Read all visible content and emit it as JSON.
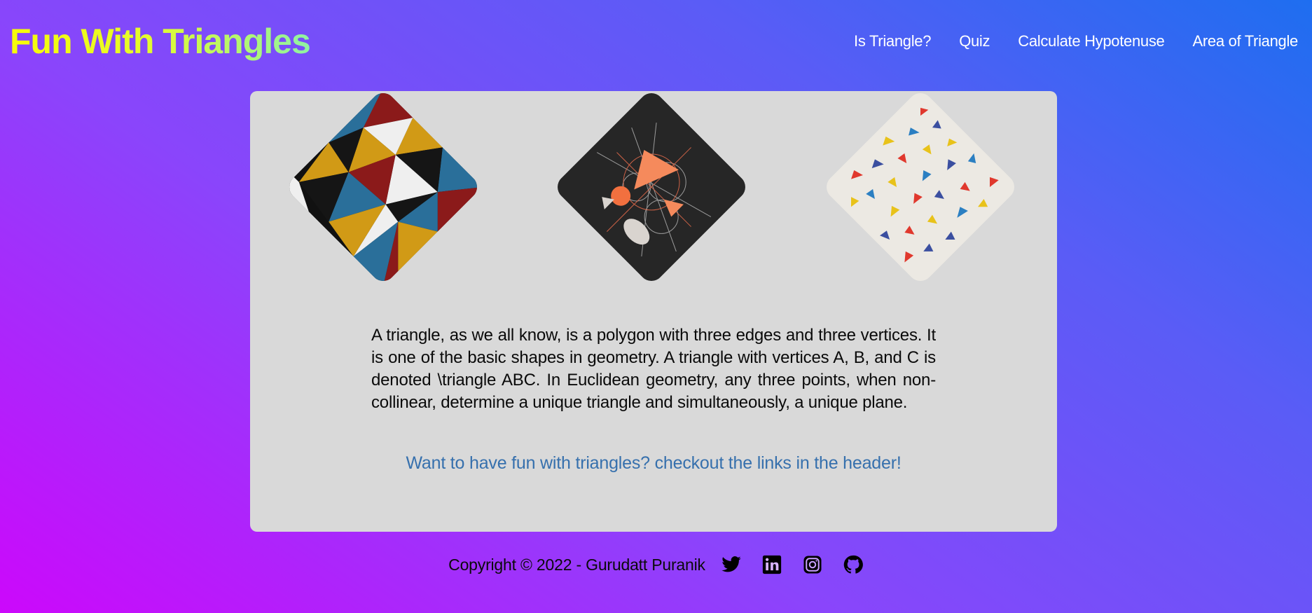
{
  "header": {
    "brand": "Fun With Triangles",
    "nav": [
      {
        "label": "Is Triangle?"
      },
      {
        "label": "Quiz"
      },
      {
        "label": "Calculate Hypotenuse"
      },
      {
        "label": "Area of Triangle"
      }
    ]
  },
  "main": {
    "images": [
      {
        "icon": "geometric-triangles-mosaic-image"
      },
      {
        "icon": "abstract-geometry-dark-image"
      },
      {
        "icon": "scattered-colored-triangles-image"
      }
    ],
    "description": "A triangle, as we all know, is a polygon with three edges and three vertices. It is one of the basic shapes in geometry. A triangle with vertices A, B, and C is denoted \\triangle ABC. In Euclidean geometry, any three points, when non-collinear, determine a unique triangle and simultaneously, a unique plane.",
    "cta": "Want to have fun with triangles? checkout the links in the header!"
  },
  "footer": {
    "copyright": "Copyright © 2022 - Gurudatt Puranik",
    "social": [
      {
        "icon": "twitter-icon"
      },
      {
        "icon": "linkedin-icon"
      },
      {
        "icon": "instagram-icon"
      },
      {
        "icon": "github-icon"
      }
    ]
  },
  "colors": {
    "background_start": "#1e6ef0",
    "background_end": "#cc08fb",
    "card": "#d9d9d9",
    "cta_text": "#3670ad",
    "brand_yellow": "#f7fb09",
    "brand_green": "#8ff2a4"
  }
}
